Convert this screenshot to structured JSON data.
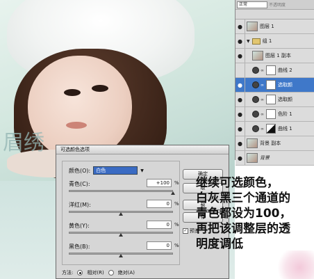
{
  "layers_panel": {
    "blend_mode": "正常",
    "opacity_label": "不透明度",
    "layers": [
      {
        "name": "图层 1",
        "visible": true,
        "type": "pixel"
      },
      {
        "name": "组 1",
        "visible": true,
        "type": "group"
      },
      {
        "name": "图层 1 副本",
        "visible": true,
        "type": "pixel"
      },
      {
        "name": "曲线 2",
        "visible": false,
        "type": "adjustment"
      },
      {
        "name": "选取颜",
        "visible": true,
        "type": "adjustment",
        "active": true
      },
      {
        "name": "选取颜",
        "visible": true,
        "type": "adjustment"
      },
      {
        "name": "色阶 1",
        "visible": true,
        "type": "adjustment"
      },
      {
        "name": "曲线 1",
        "visible": true,
        "type": "adjustment"
      },
      {
        "name": "背景 副本",
        "visible": true,
        "type": "pixel"
      },
      {
        "name": "背景",
        "visible": true,
        "type": "pixel"
      }
    ]
  },
  "dialog": {
    "title": "可选颜色选项",
    "colors_label": "颜色(O):",
    "colors_value": "白色",
    "sliders": [
      {
        "label": "青色(C):",
        "value": "+100",
        "unit": "%",
        "level": 1.0
      },
      {
        "label": "洋红(M):",
        "value": "0",
        "unit": "%",
        "level": 0.5
      },
      {
        "label": "黄色(Y):",
        "value": "0",
        "unit": "%",
        "level": 0.5
      },
      {
        "label": "黑色(B):",
        "value": "0",
        "unit": "%",
        "level": 0.5
      }
    ],
    "buttons": {
      "ok": "确定",
      "cancel": "取",
      "load": "载",
      "save": "存"
    },
    "preview_label": "预览",
    "method_label": "方法:",
    "method_relative": "相对(R)",
    "method_absolute": "绝对(A)"
  },
  "annotation": [
    "继续可选颜色，",
    "白灰黑三个通道的",
    "青色都设为100，",
    "再把该调整层的透",
    "明度调低"
  ],
  "watermark": "眉绣"
}
